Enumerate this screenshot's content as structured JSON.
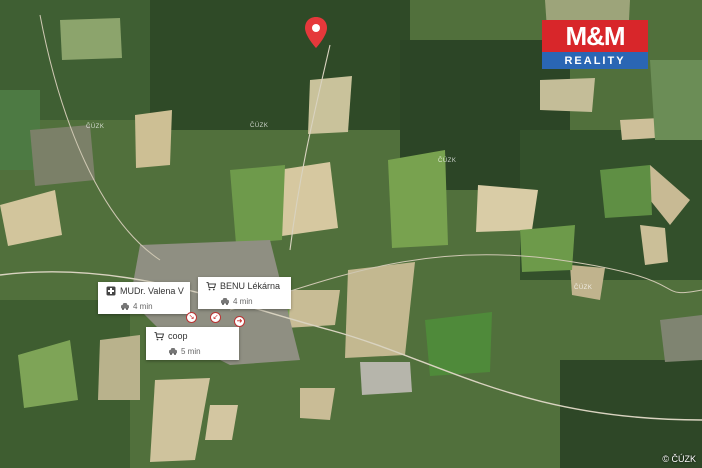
{
  "brand": {
    "logo_text": "M&M",
    "logo_subtitle": "REALITY",
    "logo_red": "#d8262a",
    "logo_blue": "#2a66b4"
  },
  "map": {
    "pin_color": "#e5383b",
    "place_labels": [
      "ČÚZK",
      "ČÚZK",
      "ČÚZK",
      "ČÚZK"
    ],
    "copyright": "© ČÚZK"
  },
  "pois": [
    {
      "name": "MUDr. Valena Vla...",
      "time": "4 min",
      "icon": "medical-cross-icon"
    },
    {
      "name": "BENU Lékárna",
      "time": "4 min",
      "icon": "shopping-cart-icon"
    },
    {
      "name": "coop",
      "time": "5 min",
      "icon": "shopping-cart-icon"
    }
  ]
}
